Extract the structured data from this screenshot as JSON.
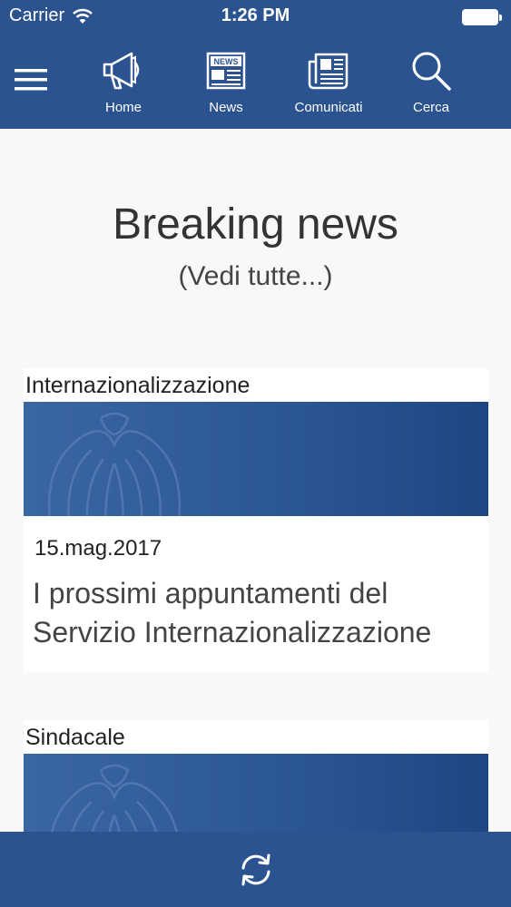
{
  "status_bar": {
    "carrier": "Carrier",
    "time": "1:26 PM"
  },
  "nav": {
    "menu_icon": "hamburger-icon",
    "items": [
      {
        "label": "Home",
        "icon": "megaphone-icon"
      },
      {
        "label": "News",
        "icon": "newspaper-icon",
        "icon_text": "NEWS"
      },
      {
        "label": "Comunicati",
        "icon": "press-release-icon"
      },
      {
        "label": "Cerca",
        "icon": "search-icon"
      }
    ]
  },
  "breaking": {
    "title": "Breaking news",
    "see_all": "(Vedi tutte...)"
  },
  "cards": [
    {
      "category": "Internazionalizzazione",
      "date": "15.mag.2017",
      "title": "I prossimi appuntamenti del Servizio Internazionalizzazione"
    },
    {
      "category": "Sindacale"
    }
  ],
  "bottom_bar": {
    "icon": "refresh-icon"
  },
  "colors": {
    "brand_blue": "#2a5390",
    "background": "#f8f8f8"
  }
}
